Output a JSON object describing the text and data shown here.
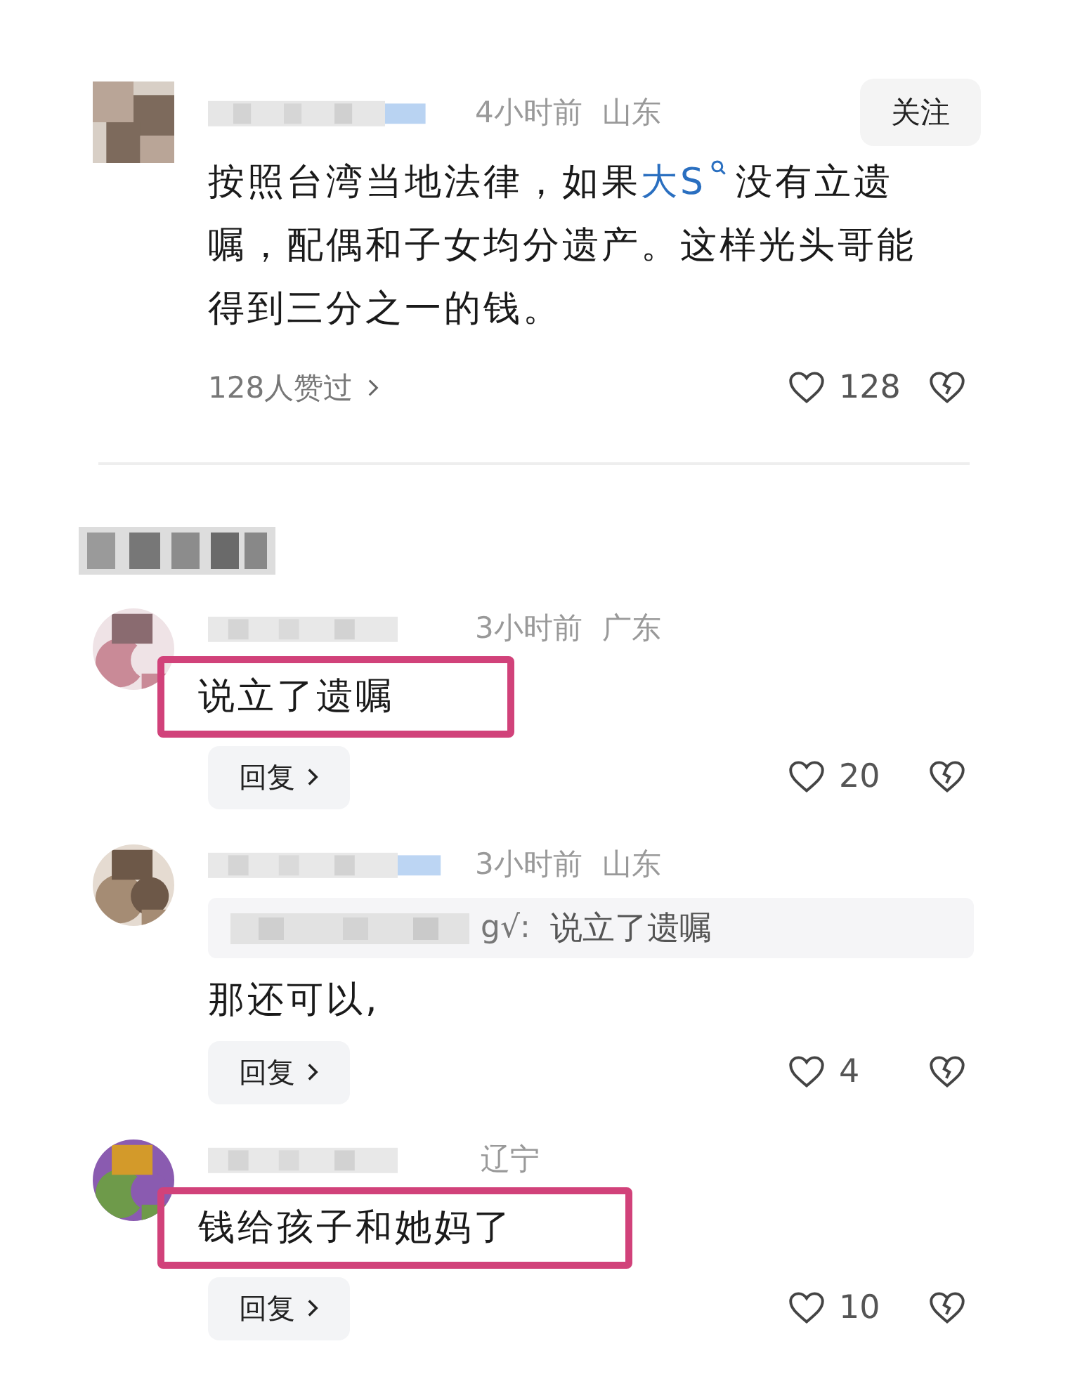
{
  "main_comment": {
    "time": "4小时前",
    "location": "山东",
    "follow_button": "关注",
    "text_before": "按照台湾当地法律，如果",
    "keyword_link": "大S",
    "text_after": "没有立遗嘱，配偶和子女均分遗产。这样光头哥能得到三分之一的钱。",
    "likes_summary": "128人赞过",
    "likes": "128"
  },
  "replies": [
    {
      "time": "3小时前",
      "location": "广东",
      "text": "说立了遗嘱",
      "highlighted": true,
      "reply_button": "回复",
      "likes": "20"
    },
    {
      "time": "3小时前",
      "location": "山东",
      "quote": {
        "prefix": "g√:",
        "text": "说立了遗嘱"
      },
      "text": "那还可以,",
      "highlighted": false,
      "reply_button": "回复",
      "likes": "4"
    },
    {
      "location": "辽宁",
      "text": "钱给孩子和她妈了",
      "highlighted": true,
      "reply_button": "回复",
      "likes": "10"
    }
  ]
}
